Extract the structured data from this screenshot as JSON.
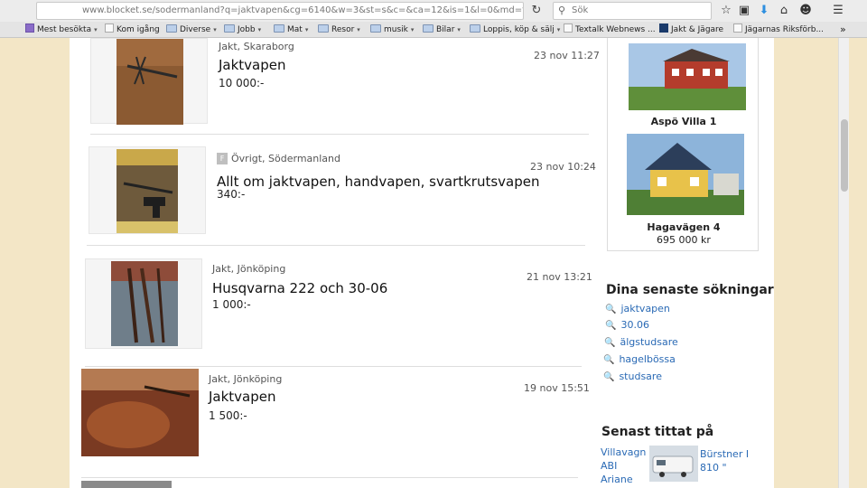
{
  "browser": {
    "url": "www.blocket.se/sodermanland?q=jaktvapen&cg=6140&w=3&st=s&c=&ca=12&is=1&l=0&md=th",
    "search_placeholder": "Sök",
    "bookmarks": [
      {
        "label": "Mest besökta",
        "folder": false,
        "dropdown": true
      },
      {
        "label": "Kom igång",
        "folder": false,
        "dropdown": false
      },
      {
        "label": "Diverse",
        "folder": true,
        "dropdown": true
      },
      {
        "label": "Jobb",
        "folder": true,
        "dropdown": true
      },
      {
        "label": "Mat",
        "folder": true,
        "dropdown": true
      },
      {
        "label": "Resor",
        "folder": true,
        "dropdown": true
      },
      {
        "label": "musik",
        "folder": true,
        "dropdown": true
      },
      {
        "label": "Bilar",
        "folder": true,
        "dropdown": true
      },
      {
        "label": "Loppis, köp & sälj",
        "folder": true,
        "dropdown": true
      },
      {
        "label": "Textalk Webnews ...",
        "folder": false,
        "dropdown": false
      },
      {
        "label": "Jakt & Jägare",
        "folder": false,
        "dropdown": false
      },
      {
        "label": "Jägarnas Riksförb...",
        "folder": false,
        "dropdown": false
      }
    ],
    "overflow_label": "»"
  },
  "listings": [
    {
      "meta": "Jakt, Skaraborg",
      "title": "Jaktvapen",
      "price": "10 000:-",
      "date": "23 nov 11:27",
      "badge": ""
    },
    {
      "meta": "Övrigt, Södermanland",
      "title": "Allt om jaktvapen, handvapen, svartkrutsvapen",
      "price": "340:-",
      "date": "23 nov 10:24",
      "badge": "F"
    },
    {
      "meta": "Jakt, Jönköping",
      "title": "Husqvarna 222 och 30-06",
      "price": "1 000:-",
      "date": "21 nov 13:21",
      "badge": ""
    },
    {
      "meta": "Jakt, Jönköping",
      "title": "Jaktvapen",
      "price": "1 500:-",
      "date": "19 nov 15:51",
      "badge": ""
    }
  ],
  "sidebar": {
    "houses": [
      {
        "name": "Aspö Villa 1",
        "price": ""
      },
      {
        "name": "Hagavägen 4",
        "price": "695 000 kr"
      }
    ],
    "recent_searches_heading": "Dina senaste sökningar",
    "recent_searches": [
      "jaktvapen",
      "30.06",
      "älgstudsare",
      "hagelbössa",
      "studsare"
    ],
    "recently_viewed_heading": "Senast tittat på",
    "recently_viewed": [
      {
        "title": "Villavagn ABI Ariane",
        "text": "Villavagn\nABI\nAriane"
      },
      {
        "title": "Bürstner I 810",
        "text": "Bürstner I\n810 \""
      }
    ]
  },
  "colors": {
    "link": "#2a6ab5",
    "page_bg": "#f3e6c6"
  }
}
